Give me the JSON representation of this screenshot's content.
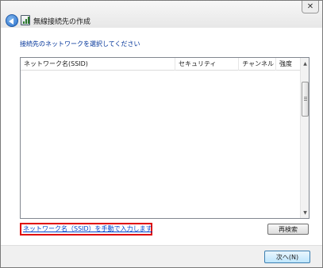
{
  "window": {
    "title": "無線接続先の作成",
    "close_glyph": "✕"
  },
  "instruction": "接続先のネットワークを選択してください",
  "list": {
    "columns": [
      "ネットワーク名(SSID)",
      "セキュリティ",
      "チャンネル",
      "強度"
    ],
    "rows": []
  },
  "scrollbar": {
    "up_glyph": "▲",
    "down_glyph": "▼"
  },
  "link": {
    "manual_entry": "ネットワーク名（SSID）を手動で入力します"
  },
  "buttons": {
    "rescan": "再検索",
    "next": "次へ(N)"
  },
  "colors": {
    "instruction_text": "#003399",
    "link_text": "#0044cc",
    "highlight_box": "#e00000"
  },
  "icons": {
    "back": "back-arrow-icon",
    "dialog": "wireless-network-icon",
    "close": "close-icon"
  }
}
